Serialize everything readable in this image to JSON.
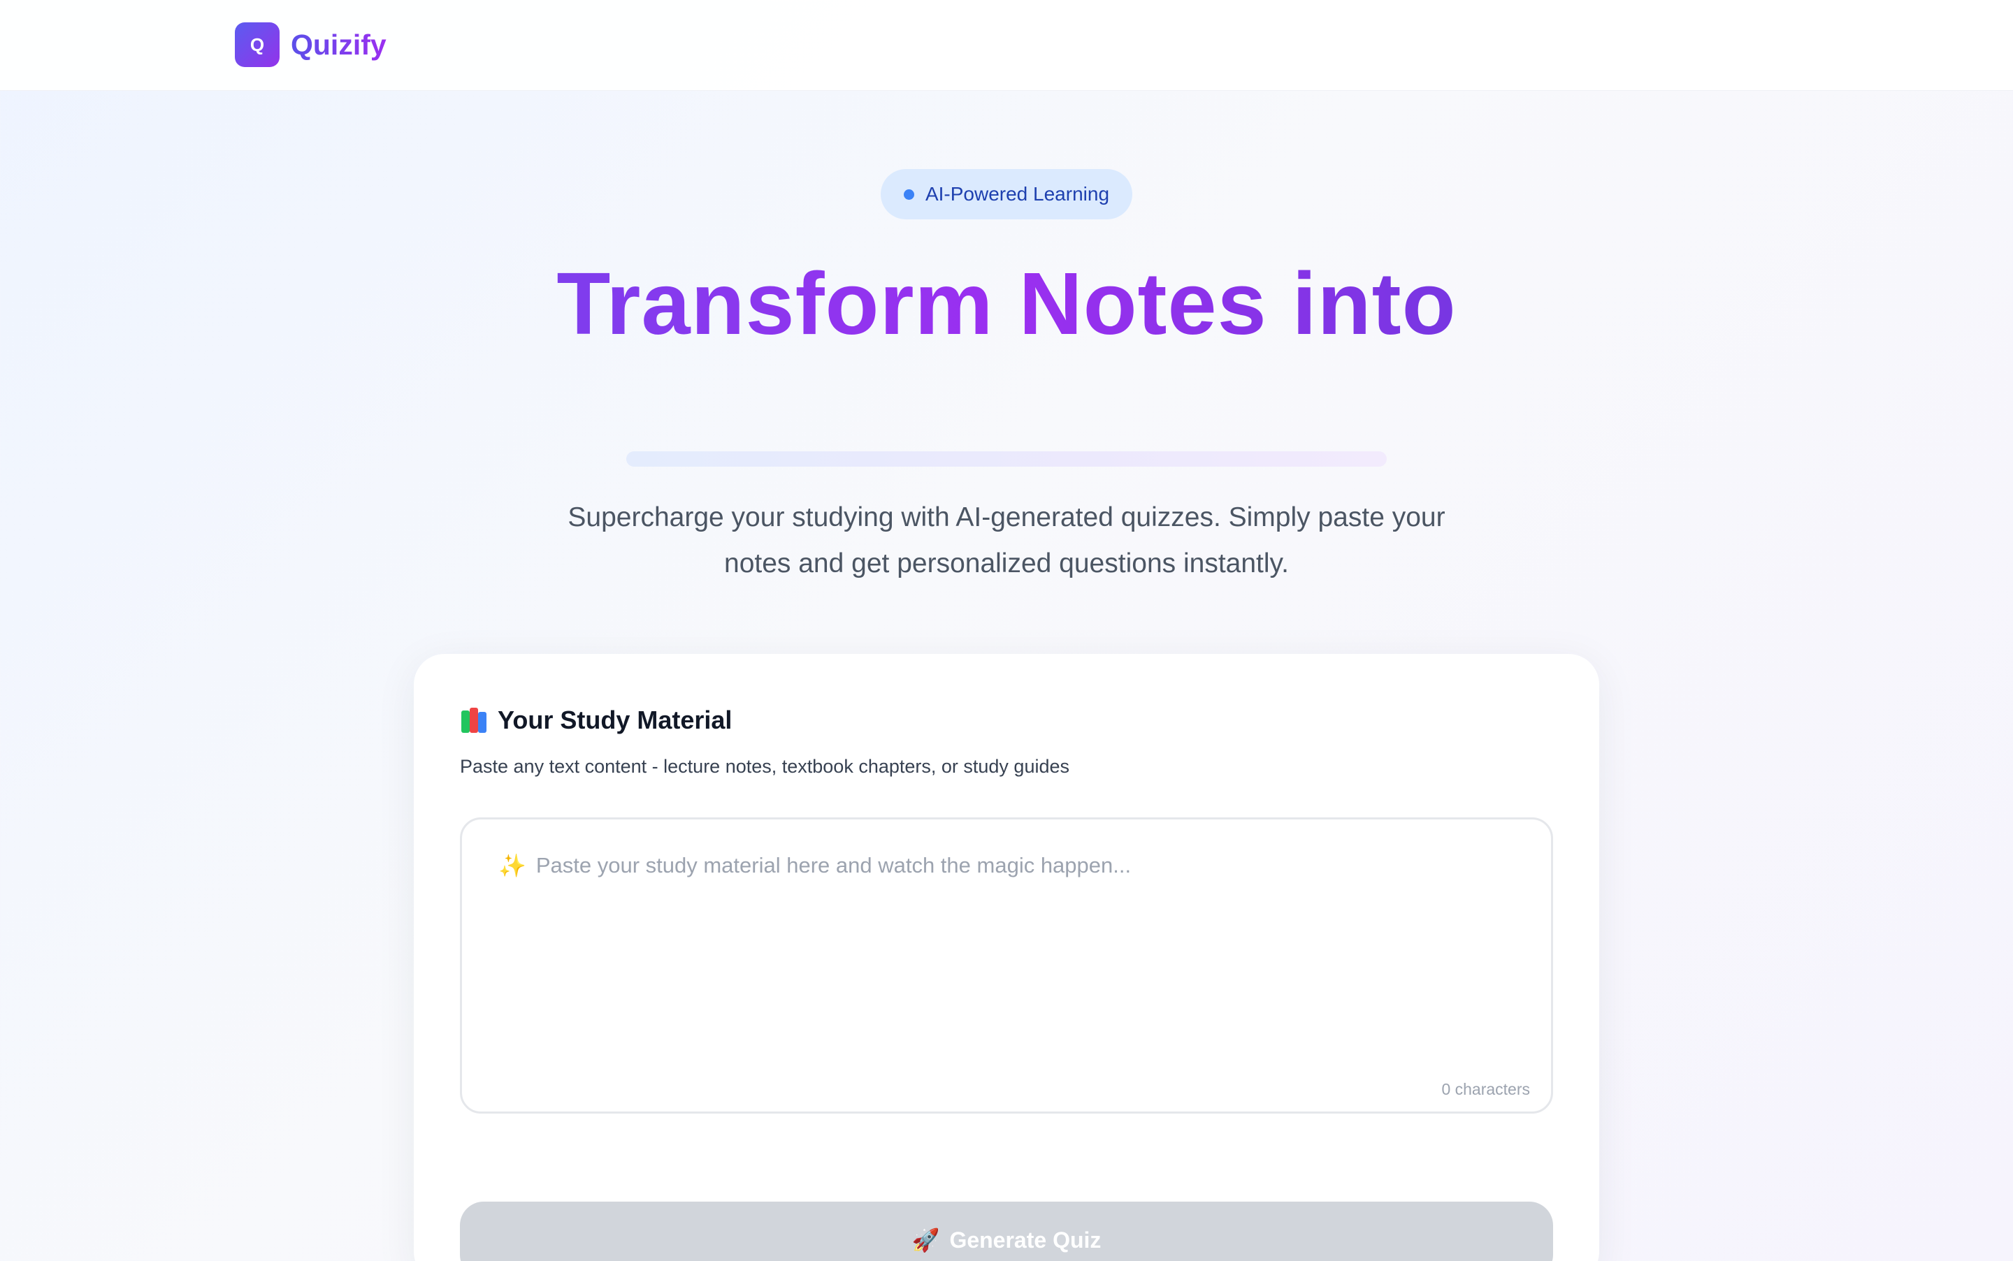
{
  "header": {
    "logo_letter": "Q",
    "brand": "Quizify"
  },
  "hero": {
    "badge": "AI-Powered Learning",
    "title": "Transform Notes into",
    "subtitle": "Supercharge your studying with AI-generated quizzes. Simply paste your notes and get personalized questions instantly."
  },
  "card": {
    "icon": "books-icon",
    "title": "Your Study Material",
    "description": "Paste any text content - lecture notes, textbook chapters, or study guides",
    "textarea": {
      "icon": "sparkle-icon",
      "placeholder": "Paste your study material here and watch the magic happen...",
      "value": "",
      "char_count": "0 characters"
    },
    "generate_button": {
      "icon": "rocket-icon",
      "label": "Generate Quiz",
      "disabled": true
    }
  },
  "colors": {
    "brand_gradient_start": "#5b4fe9",
    "brand_gradient_end": "#9b2ff0",
    "badge_bg": "#dbeafe",
    "badge_text": "#1e40af",
    "disabled_button": "#d1d5db"
  }
}
